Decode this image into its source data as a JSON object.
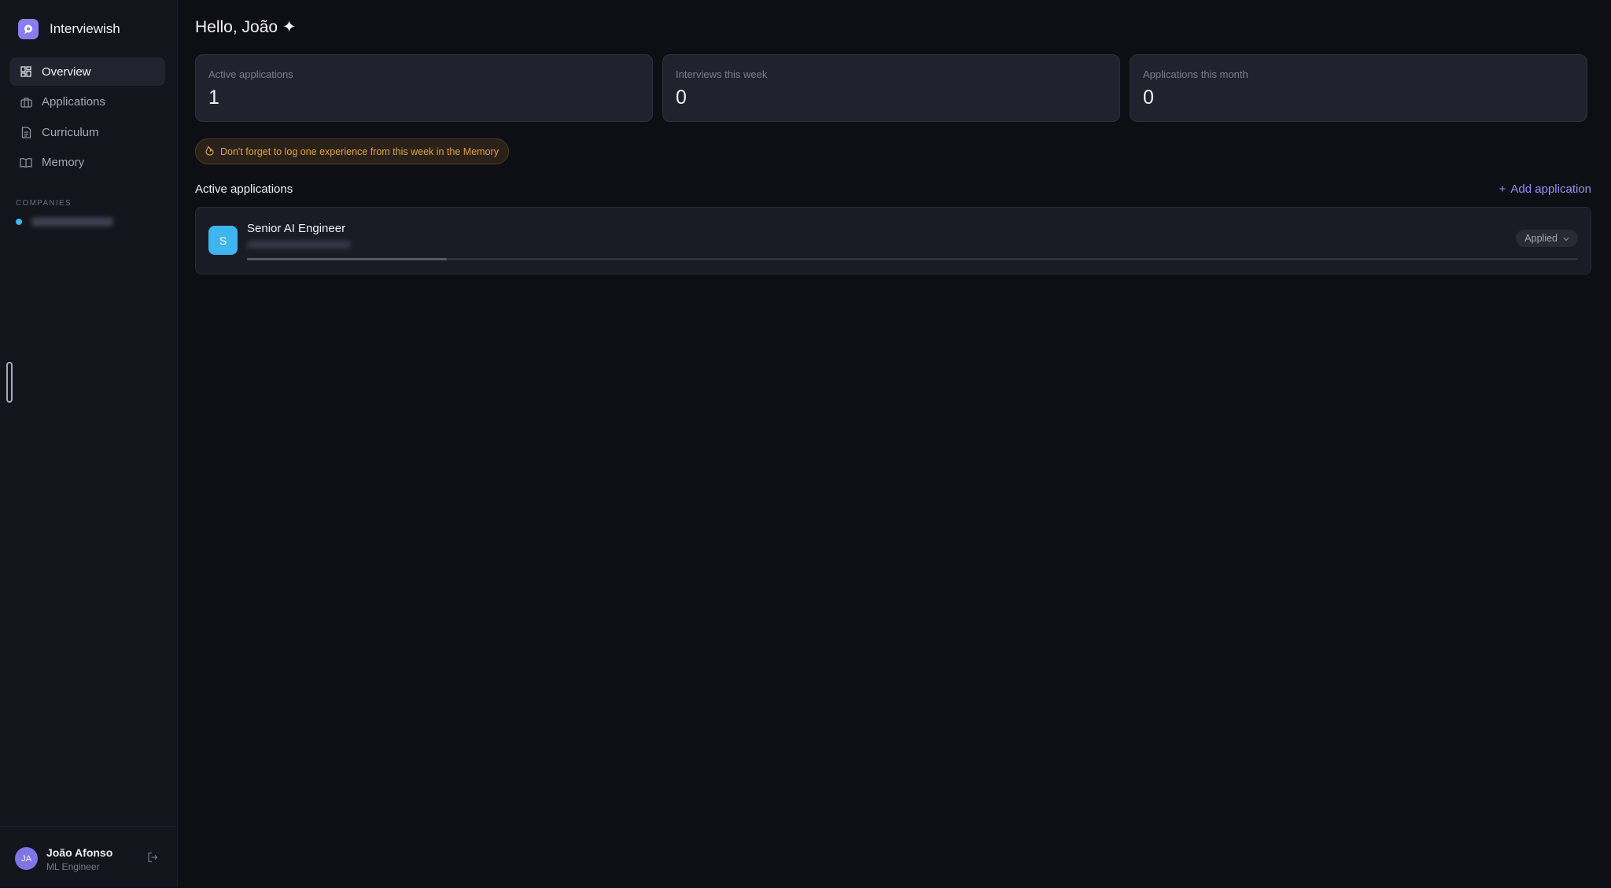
{
  "app": {
    "name": "Interviewish",
    "logo_icon": "chat-bubble-icon",
    "accent": "#8b7cf0"
  },
  "sidebar": {
    "items": [
      {
        "label": "Overview",
        "icon": "dashboard-icon",
        "active": true
      },
      {
        "label": "Applications",
        "icon": "briefcase-icon",
        "active": false
      },
      {
        "label": "Curriculum",
        "icon": "document-icon",
        "active": false
      },
      {
        "label": "Memory",
        "icon": "book-icon",
        "active": false
      }
    ],
    "companies_label": "COMPANIES",
    "companies": [
      {
        "name_blurred": true,
        "dot_color": "#3fb7f0"
      }
    ]
  },
  "user": {
    "initials": "JA",
    "name": "João Afonso",
    "role": "ML Engineer"
  },
  "main": {
    "greeting": "Hello, João ✦",
    "stats": [
      {
        "label": "Active applications",
        "value": "1"
      },
      {
        "label": "Interviews this week",
        "value": "0"
      },
      {
        "label": "Applications this month",
        "value": "0"
      }
    ],
    "reminder": "Don't forget to log one experience from this week in the Memory",
    "active_title": "Active applications",
    "add_label": "Add application",
    "applications": [
      {
        "initial": "S",
        "title": "Senior AI Engineer",
        "status": "Applied",
        "progress": 0.15,
        "avatar_color": "#3eb5ef"
      }
    ]
  }
}
